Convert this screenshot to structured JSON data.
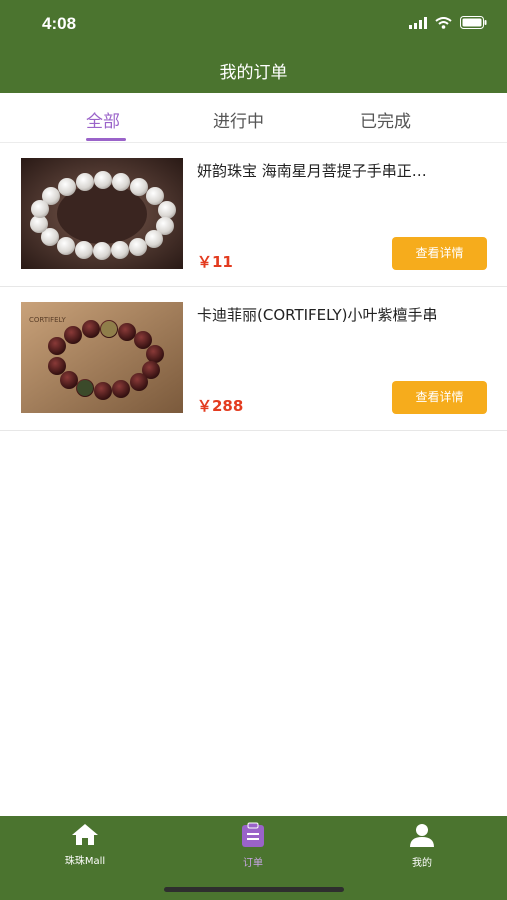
{
  "status": {
    "time": "4:08"
  },
  "header": {
    "title": "我的订单"
  },
  "tabs": [
    {
      "label": "全部",
      "active": true
    },
    {
      "label": "进行中",
      "active": false
    },
    {
      "label": "已完成",
      "active": false
    }
  ],
  "orders": [
    {
      "name": "妍韵珠宝 海南星月菩提子手串正…",
      "price": "￥11",
      "button": "查看详情",
      "image": "white-bead-bracelet"
    },
    {
      "name": "卡迪菲丽(CORTIFELY)小叶紫檀手串",
      "price": "￥288",
      "button": "查看详情",
      "image": "red-sandalwood-bracelet"
    }
  ],
  "bottom_nav": [
    {
      "label": "珠珠Mall",
      "icon": "home-icon",
      "active": false
    },
    {
      "label": "订单",
      "icon": "clipboard-icon",
      "active": true
    },
    {
      "label": "我的",
      "icon": "user-icon",
      "active": false
    }
  ],
  "colors": {
    "header": "#4b742f",
    "accent": "#9a63c9",
    "button": "#f6ac1c",
    "price": "#e33b1f"
  }
}
